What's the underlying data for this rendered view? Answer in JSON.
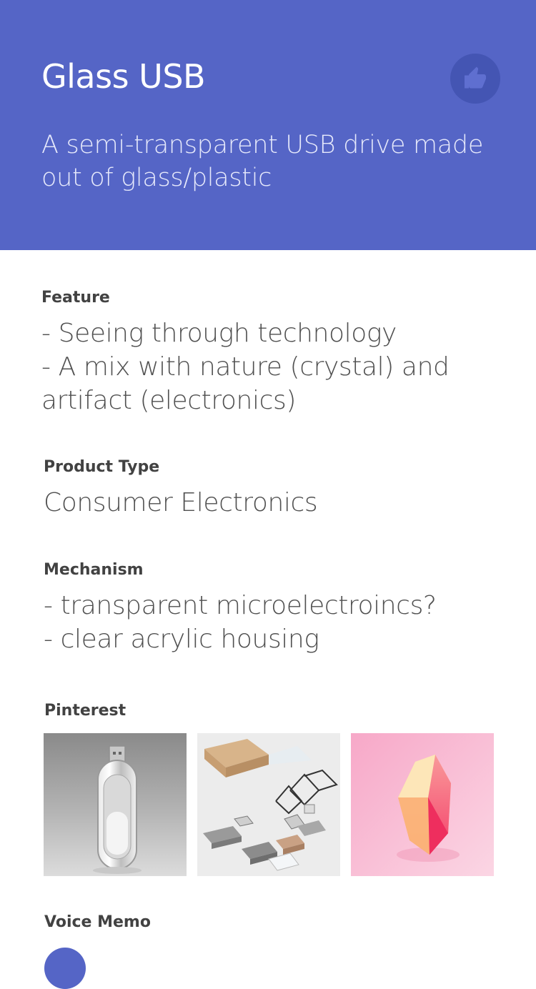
{
  "header": {
    "title": "Glass USB",
    "subtitle": "A semi-transparent USB drive made out of glass/plastic",
    "like_icon": "thumbs-up-icon",
    "background_color": "#5565c6"
  },
  "feature": {
    "label": "Feature",
    "value": "- Seeing through technology\n- A mix with nature (crystal) and artifact (electronics)"
  },
  "product_type": {
    "label": "Product Type",
    "value": "Consumer Electronics"
  },
  "mechanism": {
    "label": "Mechanism",
    "value": "- transparent microelectroincs?\n- clear acrylic housing"
  },
  "pinterest": {
    "label": "Pinterest",
    "images": [
      "glass-usb-drive-image",
      "wooden-usb-drives-image",
      "pink-crystal-image"
    ]
  },
  "voice_memo": {
    "label": "Voice Memo"
  }
}
